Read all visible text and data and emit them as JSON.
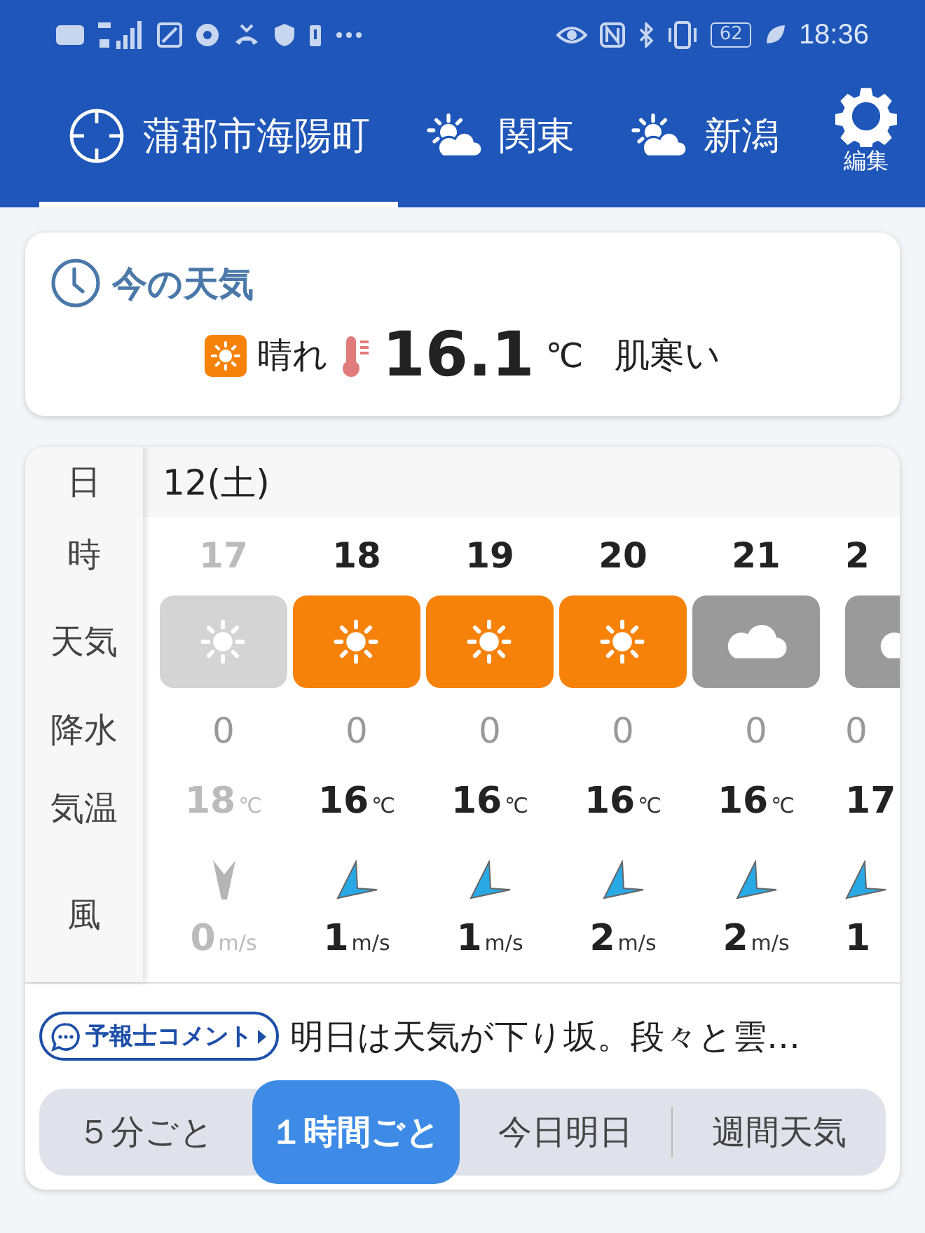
{
  "status_bar": {
    "battery": "62",
    "time": "18:36"
  },
  "tabs": [
    {
      "label": "蒲郡市海陽町",
      "kind": "location",
      "selected": true
    },
    {
      "label": "関東",
      "kind": "area",
      "selected": false
    },
    {
      "label": "新潟",
      "kind": "area",
      "selected": false
    }
  ],
  "edit_button": {
    "label": "編集"
  },
  "current": {
    "title": "今の天気",
    "kind": "sunny",
    "condition": "晴れ",
    "temperature": "16.1",
    "unit": "℃",
    "feeling": "肌寒い"
  },
  "hourly": {
    "row_labels": [
      "日",
      "時",
      "天気",
      "降水",
      "気温",
      "風"
    ],
    "date": "12(土)",
    "hours": [
      {
        "hour": "17",
        "kind": "sunny",
        "past": true,
        "precipitation": "0",
        "temperature": "18",
        "temp_unit": "℃",
        "wind": {
          "kind": "calm",
          "speed": "0",
          "unit": "m/s"
        }
      },
      {
        "hour": "18",
        "kind": "sunny",
        "past": false,
        "precipitation": "0",
        "temperature": "16",
        "temp_unit": "℃",
        "wind": {
          "kind": "arrow",
          "speed": "1",
          "unit": "m/s"
        }
      },
      {
        "hour": "19",
        "kind": "sunny",
        "past": false,
        "precipitation": "0",
        "temperature": "16",
        "temp_unit": "℃",
        "wind": {
          "kind": "arrow",
          "speed": "1",
          "unit": "m/s"
        }
      },
      {
        "hour": "20",
        "kind": "sunny",
        "past": false,
        "precipitation": "0",
        "temperature": "16",
        "temp_unit": "℃",
        "wind": {
          "kind": "arrow",
          "speed": "2",
          "unit": "m/s"
        }
      },
      {
        "hour": "21",
        "kind": "cloudy",
        "past": false,
        "precipitation": "0",
        "temperature": "16",
        "temp_unit": "℃",
        "wind": {
          "kind": "arrow",
          "speed": "2",
          "unit": "m/s"
        }
      },
      {
        "hour": "2",
        "kind": "cloudy",
        "past": false,
        "precipitation": "0",
        "temperature": "17",
        "wind": {
          "kind": "arrow",
          "speed": "1"
        }
      }
    ]
  },
  "comment": {
    "badge": "予報士コメント",
    "text": "明日は天気が下り坂。段々と雲…"
  },
  "segments": [
    {
      "label": "５分ごと",
      "selected": false
    },
    {
      "label": "１時間ごと",
      "selected": true
    },
    {
      "label": "今日明日",
      "selected": false
    },
    {
      "label": "週間天気",
      "selected": false
    }
  ]
}
